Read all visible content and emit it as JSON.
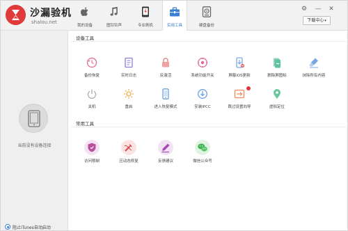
{
  "app": {
    "name": "沙漏验机",
    "domain": "shalou.net",
    "accent": "#e03a3a",
    "active_tab_color": "#3a7fd4"
  },
  "nav": {
    "tabs": [
      {
        "label": "我的设备",
        "icon": "apple-icon"
      },
      {
        "label": "图铃铃声",
        "icon": "music-note-icon"
      },
      {
        "label": "专业刷机",
        "icon": "flash-device-icon"
      },
      {
        "label": "实用工具",
        "icon": "toolbox-icon",
        "active": true
      },
      {
        "label": "硬盘备份",
        "icon": "backup-icon"
      }
    ]
  },
  "window_controls": {
    "settings": "⚙",
    "minimize": "—",
    "close": "✕"
  },
  "download_center": {
    "label": "下载中心",
    "caret": "▾"
  },
  "sidebar": {
    "no_device_text": "当前没有设备连接",
    "footer_text": "阻止iTunes自动启动"
  },
  "sections": {
    "device_tools_title": "设备工具",
    "common_tools_title": "常用工具"
  },
  "device_tools": [
    {
      "label": "备份恢复",
      "icon": "backup-restore-icon"
    },
    {
      "label": "实时日志",
      "icon": "realtime-log-icon"
    },
    {
      "label": "反激活",
      "icon": "deactivate-icon"
    },
    {
      "label": "系统功能开关",
      "icon": "system-switch-icon"
    },
    {
      "label": "屏蔽iOS更新",
      "icon": "block-ios-update-icon"
    },
    {
      "label": "删除屏图标",
      "icon": "delete-icon-icon"
    },
    {
      "label": "抹除所有内容",
      "icon": "erase-all-icon"
    },
    {
      "label": "关机",
      "icon": "power-icon"
    },
    {
      "label": "重启",
      "icon": "restart-icon"
    },
    {
      "label": "进入恢复模式",
      "icon": "recovery-mode-icon"
    },
    {
      "label": "安装IPCC",
      "icon": "install-ipcc-icon"
    },
    {
      "label": "跳过设置向导",
      "icon": "skip-setup-icon"
    },
    {
      "label": "虚拟定位",
      "icon": "virtual-location-icon"
    }
  ],
  "common_tools": [
    {
      "label": "访问限制",
      "icon": "access-restrict-icon"
    },
    {
      "label": "应动态修复",
      "icon": "repair-icon"
    },
    {
      "label": "反馈建议",
      "icon": "feedback-icon"
    },
    {
      "label": "微信公众号",
      "icon": "wechat-icon"
    }
  ]
}
